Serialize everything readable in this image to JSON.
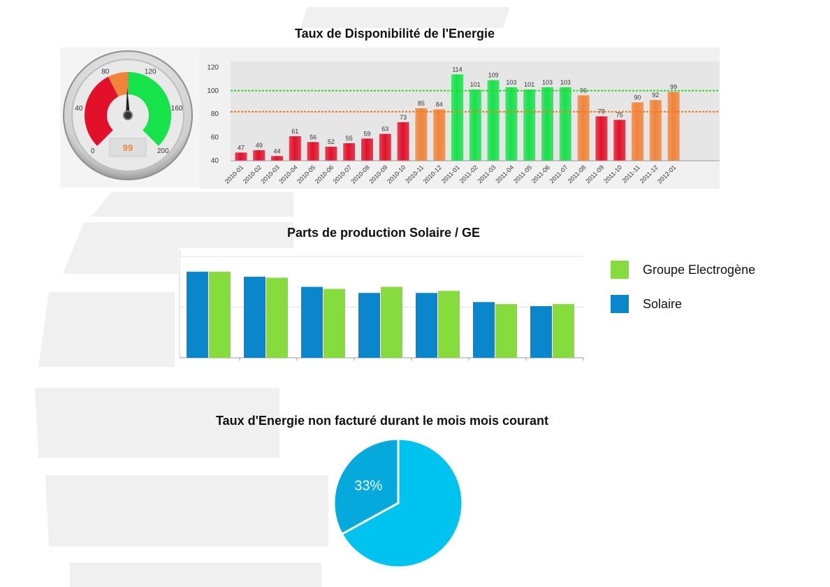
{
  "colors": {
    "red": "#e3102a",
    "orange": "#f0843a",
    "green": "#16e24a",
    "target_line": "#22dd22",
    "threshold_line": "#f07a20",
    "solaire": "#0a86cc",
    "groupe": "#86dc3c",
    "pie_main": "#00c4ef",
    "pie_slice": "#05a9db"
  },
  "gauge": {
    "value_label": "99",
    "value": 99,
    "min": 0,
    "max": 200,
    "tick_labels": [
      "0",
      "40",
      "80",
      "120",
      "160",
      "200"
    ],
    "zones": [
      {
        "from": 0,
        "to": 80,
        "color": "red"
      },
      {
        "from": 80,
        "to": 100,
        "color": "orange"
      },
      {
        "from": 100,
        "to": 200,
        "color": "green"
      }
    ]
  },
  "chart_data": [
    {
      "type": "bar",
      "title": "Taux de Disponibilité de l'Energie",
      "categories": [
        "2010-01",
        "2010-02",
        "2010-03",
        "2010-04",
        "2010-05",
        "2010-06",
        "2010-07",
        "2010-08",
        "2010-09",
        "2010-10",
        "2010-11",
        "2010-12",
        "2011-01",
        "2011-02",
        "2011-03",
        "2011-04",
        "2011-05",
        "2011-06",
        "2011-07",
        "2011-08",
        "2011-09",
        "2011-10",
        "2011-11",
        "2011-12",
        "2012-01"
      ],
      "values": [
        47,
        49,
        44,
        61,
        56,
        52,
        55,
        59,
        63,
        73,
        85,
        84,
        114,
        101,
        109,
        103,
        101,
        103,
        103,
        96,
        78,
        75,
        90,
        92,
        99
      ],
      "value_labels": [
        "47",
        "49",
        "44",
        "61",
        "56",
        "52",
        "55",
        "59",
        "63",
        "73",
        "85",
        "84",
        "114",
        "101",
        "109",
        "103",
        "101",
        "103",
        "103",
        "96",
        "78",
        "75",
        "90",
        "92",
        "99"
      ],
      "bar_colors": [
        "red",
        "red",
        "red",
        "red",
        "red",
        "red",
        "red",
        "red",
        "red",
        "red",
        "orange",
        "orange",
        "green",
        "green",
        "green",
        "green",
        "green",
        "green",
        "green",
        "orange",
        "red",
        "red",
        "orange",
        "orange",
        "orange"
      ],
      "yticks": [
        "40",
        "60",
        "80",
        "100",
        "120"
      ],
      "ylim": [
        40,
        125
      ],
      "reference_lines": [
        100,
        82
      ],
      "grid": false
    },
    {
      "type": "bar",
      "title": "Parts de production Solaire / GE",
      "series": [
        {
          "name": "Solaire",
          "values": [
            85,
            80,
            70,
            64,
            64,
            55,
            51
          ]
        },
        {
          "name": "Groupe Electrogène",
          "values": [
            85,
            79,
            68,
            70,
            66,
            53,
            53
          ]
        }
      ],
      "ylim": [
        0,
        100
      ],
      "grid": true,
      "legend": "right"
    },
    {
      "type": "pie",
      "title": "Taux d'Energie non facturé durant le mois mois courant",
      "slices": [
        {
          "label": "33%",
          "value": 33
        },
        {
          "label": "",
          "value": 67
        }
      ]
    }
  ]
}
